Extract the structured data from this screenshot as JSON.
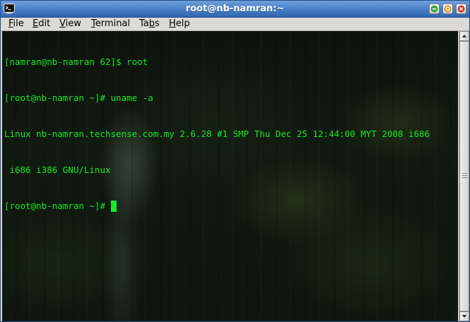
{
  "window": {
    "title": "root@nb-namran:~",
    "icon": "terminal-icon"
  },
  "window_controls": {
    "minimize_icon": "minimize-icon",
    "maximize_icon": "maximize-icon",
    "close_icon": "close-icon"
  },
  "menu": {
    "file": {
      "label": "File",
      "accel": "F",
      "rest": "ile"
    },
    "edit": {
      "label": "Edit",
      "accel": "E",
      "rest": "dit"
    },
    "view": {
      "label": "View",
      "accel": "V",
      "rest": "iew"
    },
    "terminal": {
      "label": "Terminal",
      "accel": "T",
      "rest": "erminal"
    },
    "tabs": {
      "label": "Tabs",
      "pre": "Ta",
      "accel": "b",
      "rest": "s"
    },
    "help": {
      "label": "Help",
      "accel": "H",
      "rest": "elp"
    }
  },
  "terminal": {
    "lines": [
      "[namran@nb-namran 62]$ root",
      "[root@nb-namran ~]# uname -a",
      "Linux nb-namran.techsense.com.my 2.6.28 #1 SMP Thu Dec 25 12:44:00 MYT 2008 i686",
      " i686 i386 GNU/Linux",
      "[root@nb-namran ~]# "
    ],
    "text_color": "#19e82a"
  },
  "scrollbar": {
    "up_icon": "arrow-up-icon",
    "down_icon": "arrow-down-icon"
  },
  "colors": {
    "titlebar": "#4d84c9",
    "menubar": "#dcdad5"
  }
}
